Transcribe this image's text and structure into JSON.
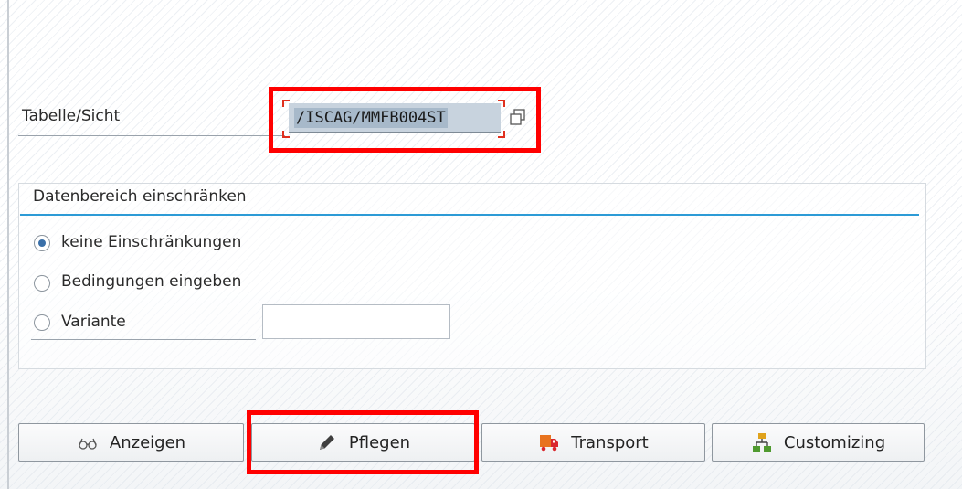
{
  "form": {
    "table_label": "Tabelle/Sicht",
    "table_value": "/ISCAG/MMFB004ST",
    "value_help_icon": "value-help-icon"
  },
  "restriction": {
    "title": "Datenbereich einschränken",
    "options": [
      {
        "label": "keine Einschränkungen",
        "checked": true
      },
      {
        "label": "Bedingungen eingeben",
        "checked": false
      },
      {
        "label": "Variante",
        "checked": false
      }
    ],
    "variant_value": ""
  },
  "buttons": {
    "anzeigen": {
      "label": "Anzeigen",
      "icon": "glasses-icon"
    },
    "pflegen": {
      "label": "Pflegen",
      "icon": "pencil-icon"
    },
    "transport": {
      "label": "Transport",
      "icon": "truck-icon"
    },
    "customizing": {
      "label": "Customizing",
      "icon": "hierarchy-icon"
    }
  },
  "colors": {
    "highlight": "#ff0000",
    "accent_rule": "#2d9bd6",
    "input_bg": "#c8d3de"
  }
}
